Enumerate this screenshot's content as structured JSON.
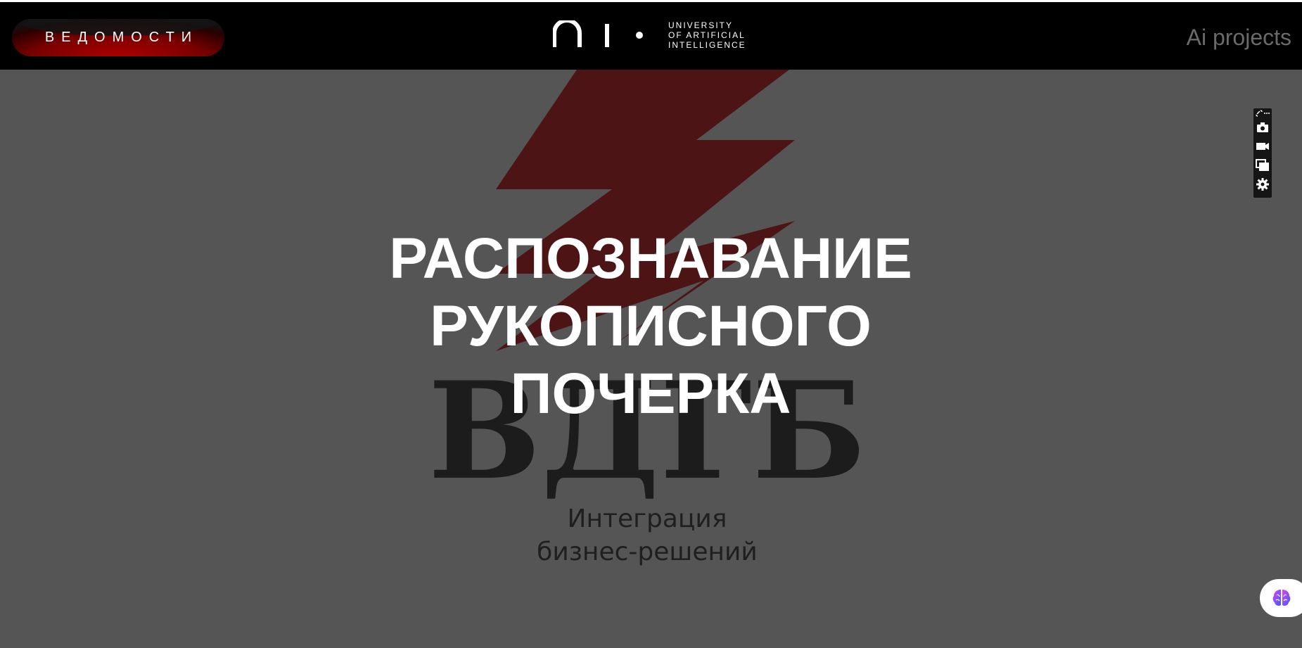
{
  "header": {
    "brand_pill_label": "ВЕДОМОСТИ",
    "logo_text_lines": [
      "UNIVERSITY",
      "OF ARTIFICIAL",
      "INTELLIGENCE"
    ],
    "ai_projects_link": "Ai projects"
  },
  "hero": {
    "title_lines": [
      "РАСПОЗНАВАНИЕ",
      "РУКОПИСНОГО",
      "ПОЧЕРКА"
    ],
    "background_logo_text": "ВДГБ",
    "background_caption_lines": [
      "Интеграция",
      "бизнес-решений"
    ]
  },
  "toolbar": {
    "icons": [
      "link-icon",
      "more-icon",
      "camera-icon",
      "video-icon",
      "copy-icon",
      "settings-icon"
    ]
  },
  "colors": {
    "header_bg": "#000000",
    "page_bg": "#555555",
    "accent_red": "#8b0000",
    "muted_link": "#6a6a6a"
  }
}
